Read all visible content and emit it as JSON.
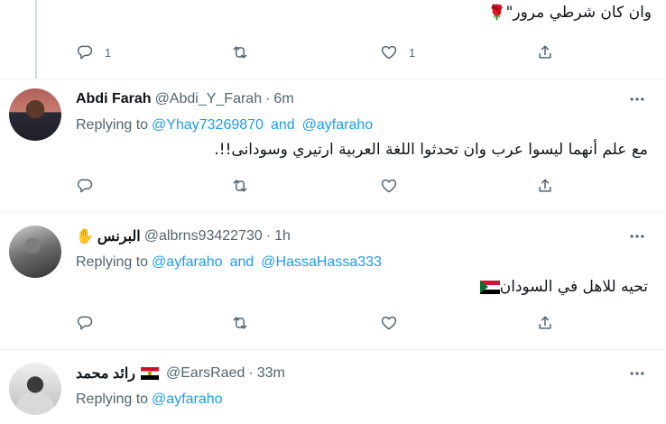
{
  "top_tweet": {
    "text": "وان كان شرطي مرور\"",
    "reply_count": "1",
    "like_count": "1"
  },
  "replying_label": "Replying to",
  "and_label": "and",
  "tweets": [
    {
      "name": "Abdi Farah",
      "handle": "@Abdi_Y_Farah",
      "dot": "·",
      "time": "6m",
      "replying_to": [
        "@Yhay73269870",
        "@ayfaraho"
      ],
      "text": "مع علم أنهما ليسوا عرب وان تحدثوا اللغة العربية ارتيري وسودانى!!."
    },
    {
      "name": "البرنس",
      "handle": "@albrns93422730",
      "dot": "·",
      "time": "1h",
      "replying_to": [
        "@ayfaraho",
        "@HassaHassa333"
      ],
      "text": "تحيه للاهل في السودان"
    },
    {
      "name": "رائد محمد",
      "handle": "@EarsRaed",
      "dot": "·",
      "time": "33m",
      "replying_to": [
        "@ayfaraho"
      ]
    }
  ],
  "icons": {
    "reply": "reply-icon",
    "retweet": "retweet-icon",
    "like": "heart-icon",
    "share": "share-icon",
    "more": "more-icon"
  },
  "colors": {
    "link": "#1d9bf0",
    "muted": "#536471",
    "text": "#0f1419"
  }
}
